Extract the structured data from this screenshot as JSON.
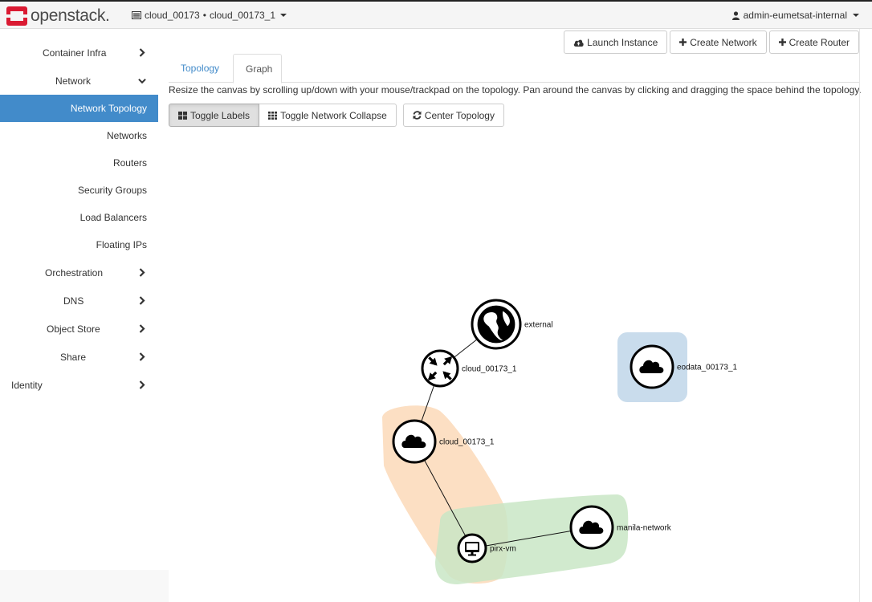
{
  "brand": {
    "name": "openstack.",
    "color": "#da1a32"
  },
  "header": {
    "project_selector": {
      "project": "cloud_00173",
      "separator": "•",
      "region": "cloud_00173_1"
    },
    "user_menu": {
      "label": "admin-eumetsat-internal"
    }
  },
  "page_actions": {
    "launch_instance": "Launch Instance",
    "create_network": "Create Network",
    "create_router": "Create Router"
  },
  "sidebar": {
    "accent": "#428bca",
    "sections": [
      {
        "label": "Container Infra",
        "state": "collapsed"
      },
      {
        "label": "Network",
        "state": "expanded",
        "items": [
          {
            "label": "Network Topology",
            "active": true
          },
          {
            "label": "Networks"
          },
          {
            "label": "Routers"
          },
          {
            "label": "Security Groups"
          },
          {
            "label": "Load Balancers"
          },
          {
            "label": "Floating IPs"
          }
        ]
      },
      {
        "label": "Orchestration",
        "state": "collapsed"
      },
      {
        "label": "DNS",
        "state": "collapsed"
      },
      {
        "label": "Object Store",
        "state": "collapsed"
      },
      {
        "label": "Share",
        "state": "collapsed"
      },
      {
        "label": "Identity",
        "state": "collapsed"
      }
    ]
  },
  "tabs": [
    {
      "label": "Topology",
      "active": false
    },
    {
      "label": "Graph",
      "active": true
    }
  ],
  "help_text": "Resize the canvas by scrolling up/down with your mouse/trackpad on the topology. Pan around the canvas by clicking and dragging the space behind the topology.",
  "toolbar": {
    "toggle_labels": "Toggle Labels",
    "toggle_network_collapse": "Toggle Network Collapse",
    "center_topology": "Center Topology"
  },
  "graph": {
    "nodes": [
      {
        "id": "external",
        "label": "external",
        "type": "external-network",
        "icon": "globe-icon"
      },
      {
        "id": "router",
        "label": "cloud_00173_1",
        "type": "router",
        "icon": "router-arrows-icon"
      },
      {
        "id": "net_cloud",
        "label": "cloud_00173_1",
        "type": "network",
        "icon": "cloud-icon"
      },
      {
        "id": "eodata",
        "label": "eodata_00173_1",
        "type": "network",
        "icon": "cloud-icon"
      },
      {
        "id": "manila",
        "label": "manila-network",
        "type": "network",
        "icon": "cloud-icon"
      },
      {
        "id": "vm",
        "label": "pirx-vm",
        "type": "instance",
        "icon": "monitor-icon"
      }
    ],
    "links": [
      {
        "source": "external",
        "target": "router"
      },
      {
        "source": "router",
        "target": "net_cloud"
      },
      {
        "source": "net_cloud",
        "target": "vm"
      },
      {
        "source": "vm",
        "target": "manila"
      }
    ],
    "network_hull_colors": {
      "net_cloud": "#fbd9b9",
      "manila": "#c9e6c6",
      "eodata": "#c9dcec"
    }
  }
}
